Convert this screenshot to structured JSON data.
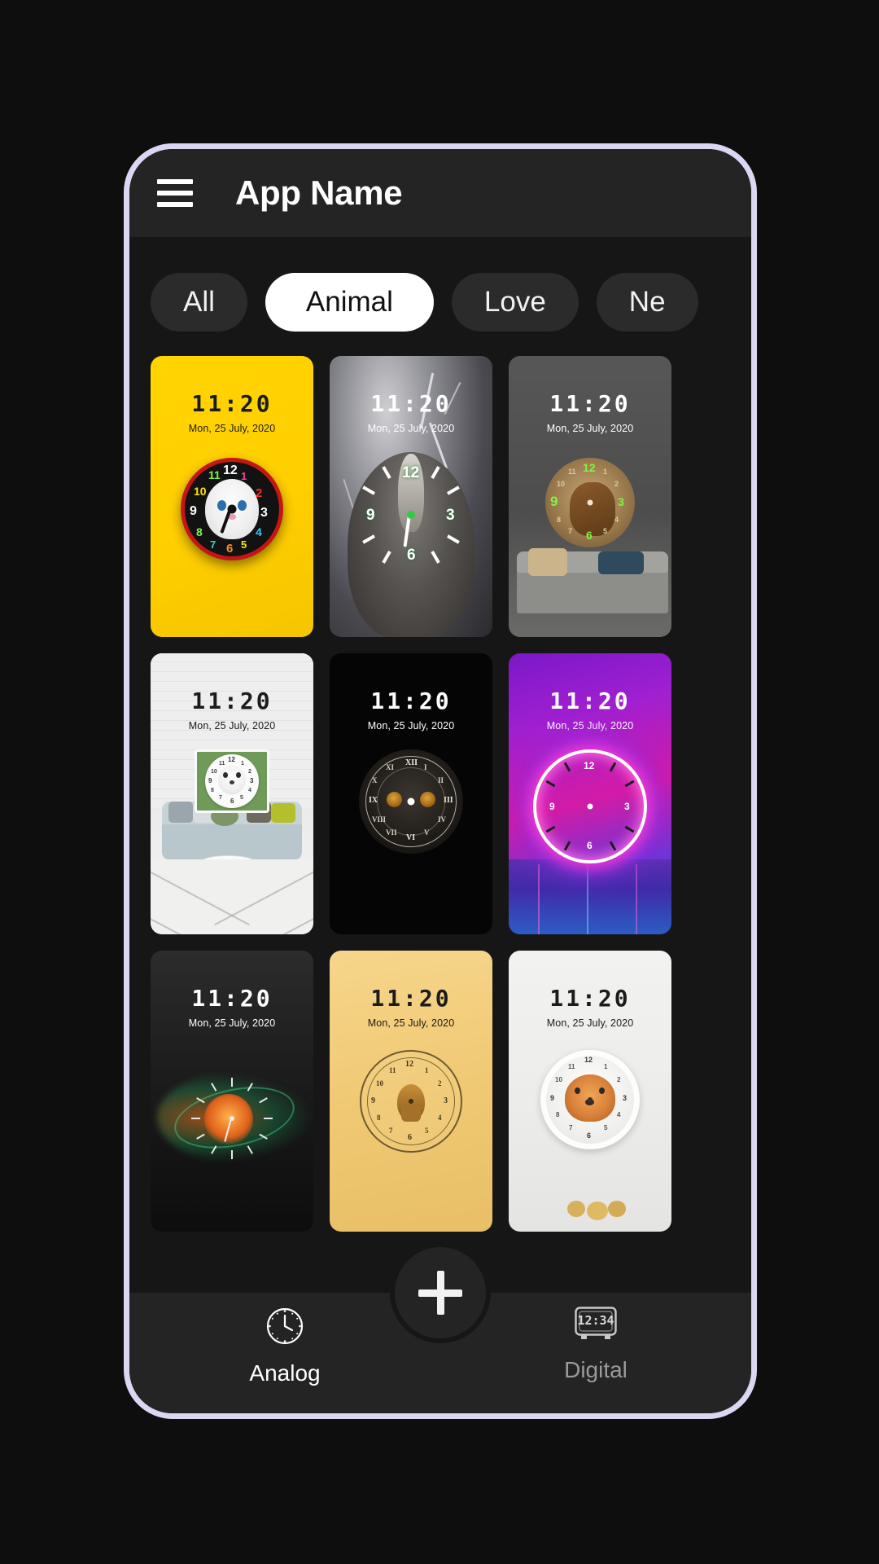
{
  "app": {
    "title": "App Name",
    "menu_icon": "hamburger-menu-icon"
  },
  "categories": {
    "items": [
      {
        "label": "All",
        "selected": false
      },
      {
        "label": "Animal",
        "selected": true
      },
      {
        "label": "Love",
        "selected": false
      },
      {
        "label": "Ne",
        "selected": false
      }
    ]
  },
  "wallpaper_common": {
    "time": "11:20",
    "date": "Mon, 25 July, 2020"
  },
  "wallpapers": [
    {
      "id": 1,
      "name": "kitten-on-yellow",
      "theme": "light",
      "bg": "bg-yellow",
      "clock": "kitten"
    },
    {
      "id": 2,
      "name": "eagle-storm",
      "theme": "dark",
      "bg": "bg-storm",
      "clock": "eagle"
    },
    {
      "id": 3,
      "name": "horse-in-room",
      "theme": "dark",
      "bg": "bg-room",
      "clock": "horse"
    },
    {
      "id": 4,
      "name": "dog-wall-clock",
      "theme": "light",
      "bg": "bg-wall",
      "clock": "dog"
    },
    {
      "id": 5,
      "name": "owl-roman-numeral",
      "theme": "dark",
      "bg": "bg-black",
      "clock": "owl"
    },
    {
      "id": 6,
      "name": "neon-purple-ring",
      "theme": "dark",
      "bg": "bg-neon",
      "clock": "neon"
    },
    {
      "id": 7,
      "name": "colorful-smoke",
      "theme": "dark",
      "bg": "bg-dark2",
      "clock": "smoke"
    },
    {
      "id": 8,
      "name": "vintage-gold",
      "theme": "light",
      "bg": "bg-gold",
      "clock": "vintage"
    },
    {
      "id": 9,
      "name": "fox-in-snow",
      "theme": "light",
      "bg": "bg-snow",
      "clock": "fox"
    }
  ],
  "fab": {
    "label": "add-wallpaper",
    "icon": "plus-icon"
  },
  "bottom_nav": {
    "items": [
      {
        "label": "Analog",
        "icon": "analog-clock-icon",
        "active": true
      },
      {
        "label": "Digital",
        "icon": "digital-clock-icon",
        "active": false
      }
    ],
    "digital_icon_time": "12:34"
  },
  "colors": {
    "page_background": "#0e0e0e",
    "phone_border": "#ddd6f3",
    "appbar": "#242424",
    "screen": "#161616",
    "chip": "#2b2b2b",
    "chip_active": "#ffffff",
    "accent_yellow": "#ffd400",
    "inactive_text": "#9a9a9a"
  }
}
